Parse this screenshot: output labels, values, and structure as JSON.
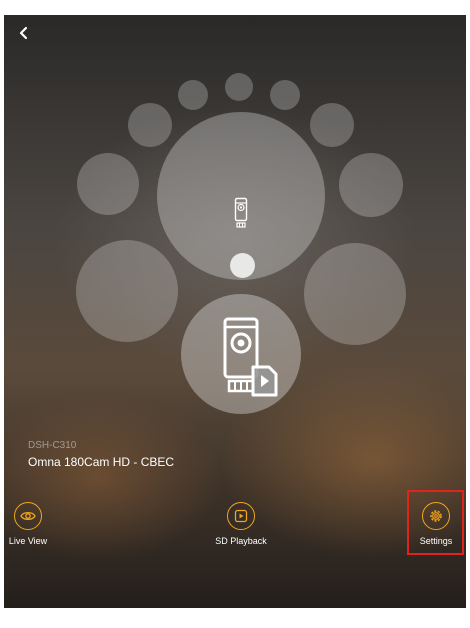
{
  "header": {
    "back_icon": "chevron-left-icon"
  },
  "device": {
    "model": "DSH-C310",
    "name": "Omna 180Cam HD - CBEC"
  },
  "actions": [
    {
      "label": "Live View",
      "icon": "eye-icon"
    },
    {
      "label": "SD Playback",
      "icon": "playback-icon"
    },
    {
      "label": "Settings",
      "icon": "gear-icon"
    }
  ],
  "colors": {
    "accent": "#f0a51c",
    "highlight": "#e0231b"
  }
}
